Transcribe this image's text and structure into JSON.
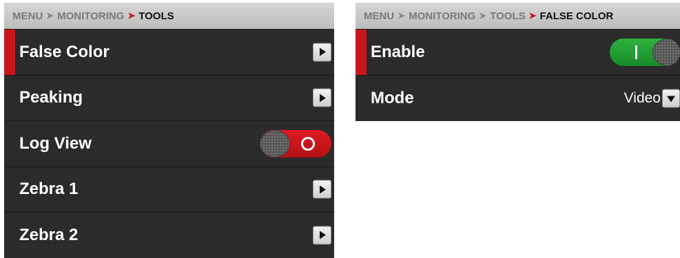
{
  "left_panel": {
    "breadcrumb": [
      "MENU",
      "MONITORING",
      "TOOLS"
    ],
    "items": [
      {
        "label": "False Color",
        "control": "arrow",
        "selected": true
      },
      {
        "label": "Peaking",
        "control": "arrow"
      },
      {
        "label": "Log View",
        "control": "toggle",
        "state": "off"
      },
      {
        "label": "Zebra 1",
        "control": "arrow"
      },
      {
        "label": "Zebra 2",
        "control": "arrow"
      }
    ]
  },
  "right_panel": {
    "breadcrumb": [
      "MENU",
      "MONITORING",
      "TOOLS",
      "FALSE COLOR"
    ],
    "items": [
      {
        "label": "Enable",
        "control": "toggle",
        "state": "on",
        "selected": true
      },
      {
        "label": "Mode",
        "control": "dropdown",
        "value": "Video"
      }
    ]
  },
  "colors": {
    "accent_red": "#c8171c",
    "toggle_on_green": "#2eb13f",
    "panel_bg": "#2b2b2b",
    "breadcrumb_bg": "#cfcfcf"
  },
  "icons": {
    "navigate": "chevron-right-icon",
    "dropdown": "chevron-down-icon",
    "toggle_off": "circle-icon",
    "toggle_on": "bar-icon"
  }
}
